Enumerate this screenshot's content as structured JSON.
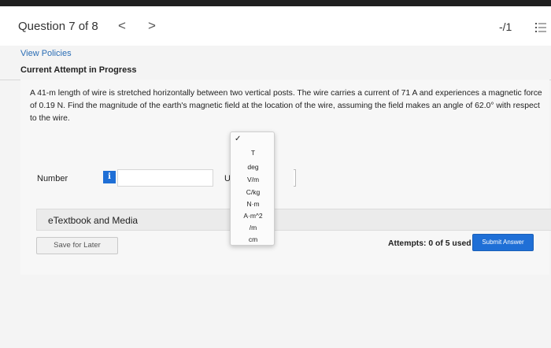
{
  "header": {
    "question_title": "Question 7 of 8",
    "prev_glyph": "<",
    "next_glyph": ">",
    "score": "-/1"
  },
  "policies": {
    "link": "View Policies"
  },
  "attempt": {
    "status": "Current Attempt in Progress"
  },
  "question": {
    "text": "A 41-m length of wire is stretched horizontally between two vertical posts. The wire carries a current of 71 A and experiences a magnetic force of 0.19 N. Find the magnitude of the earth's magnetic field at the location of the wire, assuming the field makes an angle of 62.0° with respect to the wire."
  },
  "answer": {
    "number_label": "Number",
    "info_glyph": "i",
    "number_value": "",
    "units_label": "Units"
  },
  "units_dropdown": {
    "check": "✓",
    "options": [
      "T",
      "deg",
      "V/m",
      "C/kg",
      "N·m",
      "A·m^2",
      "/m",
      "cm"
    ]
  },
  "etextbook": {
    "label": "eTextbook and Media"
  },
  "footer": {
    "save_later": "Save for Later",
    "attempts": "Attempts: 0 of 5 used",
    "submit": "Submit Answer"
  },
  "colors": {
    "accent": "#1f6fd6",
    "link": "#2a6db5"
  }
}
